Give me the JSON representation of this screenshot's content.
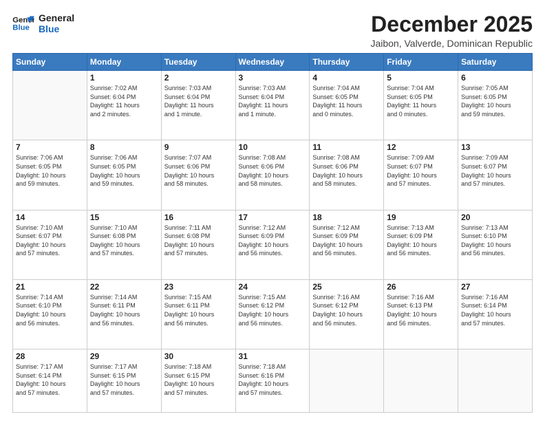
{
  "header": {
    "logo_line1": "General",
    "logo_line2": "Blue",
    "title": "December 2025",
    "location": "Jaibon, Valverde, Dominican Republic"
  },
  "weekdays": [
    "Sunday",
    "Monday",
    "Tuesday",
    "Wednesday",
    "Thursday",
    "Friday",
    "Saturday"
  ],
  "weeks": [
    [
      {
        "day": "",
        "text": ""
      },
      {
        "day": "1",
        "text": "Sunrise: 7:02 AM\nSunset: 6:04 PM\nDaylight: 11 hours\nand 2 minutes."
      },
      {
        "day": "2",
        "text": "Sunrise: 7:03 AM\nSunset: 6:04 PM\nDaylight: 11 hours\nand 1 minute."
      },
      {
        "day": "3",
        "text": "Sunrise: 7:03 AM\nSunset: 6:04 PM\nDaylight: 11 hours\nand 1 minute."
      },
      {
        "day": "4",
        "text": "Sunrise: 7:04 AM\nSunset: 6:05 PM\nDaylight: 11 hours\nand 0 minutes."
      },
      {
        "day": "5",
        "text": "Sunrise: 7:04 AM\nSunset: 6:05 PM\nDaylight: 11 hours\nand 0 minutes."
      },
      {
        "day": "6",
        "text": "Sunrise: 7:05 AM\nSunset: 6:05 PM\nDaylight: 10 hours\nand 59 minutes."
      }
    ],
    [
      {
        "day": "7",
        "text": "Sunrise: 7:06 AM\nSunset: 6:05 PM\nDaylight: 10 hours\nand 59 minutes."
      },
      {
        "day": "8",
        "text": "Sunrise: 7:06 AM\nSunset: 6:05 PM\nDaylight: 10 hours\nand 59 minutes."
      },
      {
        "day": "9",
        "text": "Sunrise: 7:07 AM\nSunset: 6:06 PM\nDaylight: 10 hours\nand 58 minutes."
      },
      {
        "day": "10",
        "text": "Sunrise: 7:08 AM\nSunset: 6:06 PM\nDaylight: 10 hours\nand 58 minutes."
      },
      {
        "day": "11",
        "text": "Sunrise: 7:08 AM\nSunset: 6:06 PM\nDaylight: 10 hours\nand 58 minutes."
      },
      {
        "day": "12",
        "text": "Sunrise: 7:09 AM\nSunset: 6:07 PM\nDaylight: 10 hours\nand 57 minutes."
      },
      {
        "day": "13",
        "text": "Sunrise: 7:09 AM\nSunset: 6:07 PM\nDaylight: 10 hours\nand 57 minutes."
      }
    ],
    [
      {
        "day": "14",
        "text": "Sunrise: 7:10 AM\nSunset: 6:07 PM\nDaylight: 10 hours\nand 57 minutes."
      },
      {
        "day": "15",
        "text": "Sunrise: 7:10 AM\nSunset: 6:08 PM\nDaylight: 10 hours\nand 57 minutes."
      },
      {
        "day": "16",
        "text": "Sunrise: 7:11 AM\nSunset: 6:08 PM\nDaylight: 10 hours\nand 57 minutes."
      },
      {
        "day": "17",
        "text": "Sunrise: 7:12 AM\nSunset: 6:09 PM\nDaylight: 10 hours\nand 56 minutes."
      },
      {
        "day": "18",
        "text": "Sunrise: 7:12 AM\nSunset: 6:09 PM\nDaylight: 10 hours\nand 56 minutes."
      },
      {
        "day": "19",
        "text": "Sunrise: 7:13 AM\nSunset: 6:09 PM\nDaylight: 10 hours\nand 56 minutes."
      },
      {
        "day": "20",
        "text": "Sunrise: 7:13 AM\nSunset: 6:10 PM\nDaylight: 10 hours\nand 56 minutes."
      }
    ],
    [
      {
        "day": "21",
        "text": "Sunrise: 7:14 AM\nSunset: 6:10 PM\nDaylight: 10 hours\nand 56 minutes."
      },
      {
        "day": "22",
        "text": "Sunrise: 7:14 AM\nSunset: 6:11 PM\nDaylight: 10 hours\nand 56 minutes."
      },
      {
        "day": "23",
        "text": "Sunrise: 7:15 AM\nSunset: 6:11 PM\nDaylight: 10 hours\nand 56 minutes."
      },
      {
        "day": "24",
        "text": "Sunrise: 7:15 AM\nSunset: 6:12 PM\nDaylight: 10 hours\nand 56 minutes."
      },
      {
        "day": "25",
        "text": "Sunrise: 7:16 AM\nSunset: 6:12 PM\nDaylight: 10 hours\nand 56 minutes."
      },
      {
        "day": "26",
        "text": "Sunrise: 7:16 AM\nSunset: 6:13 PM\nDaylight: 10 hours\nand 56 minutes."
      },
      {
        "day": "27",
        "text": "Sunrise: 7:16 AM\nSunset: 6:14 PM\nDaylight: 10 hours\nand 57 minutes."
      }
    ],
    [
      {
        "day": "28",
        "text": "Sunrise: 7:17 AM\nSunset: 6:14 PM\nDaylight: 10 hours\nand 57 minutes."
      },
      {
        "day": "29",
        "text": "Sunrise: 7:17 AM\nSunset: 6:15 PM\nDaylight: 10 hours\nand 57 minutes."
      },
      {
        "day": "30",
        "text": "Sunrise: 7:18 AM\nSunset: 6:15 PM\nDaylight: 10 hours\nand 57 minutes."
      },
      {
        "day": "31",
        "text": "Sunrise: 7:18 AM\nSunset: 6:16 PM\nDaylight: 10 hours\nand 57 minutes."
      },
      {
        "day": "",
        "text": ""
      },
      {
        "day": "",
        "text": ""
      },
      {
        "day": "",
        "text": ""
      }
    ]
  ]
}
